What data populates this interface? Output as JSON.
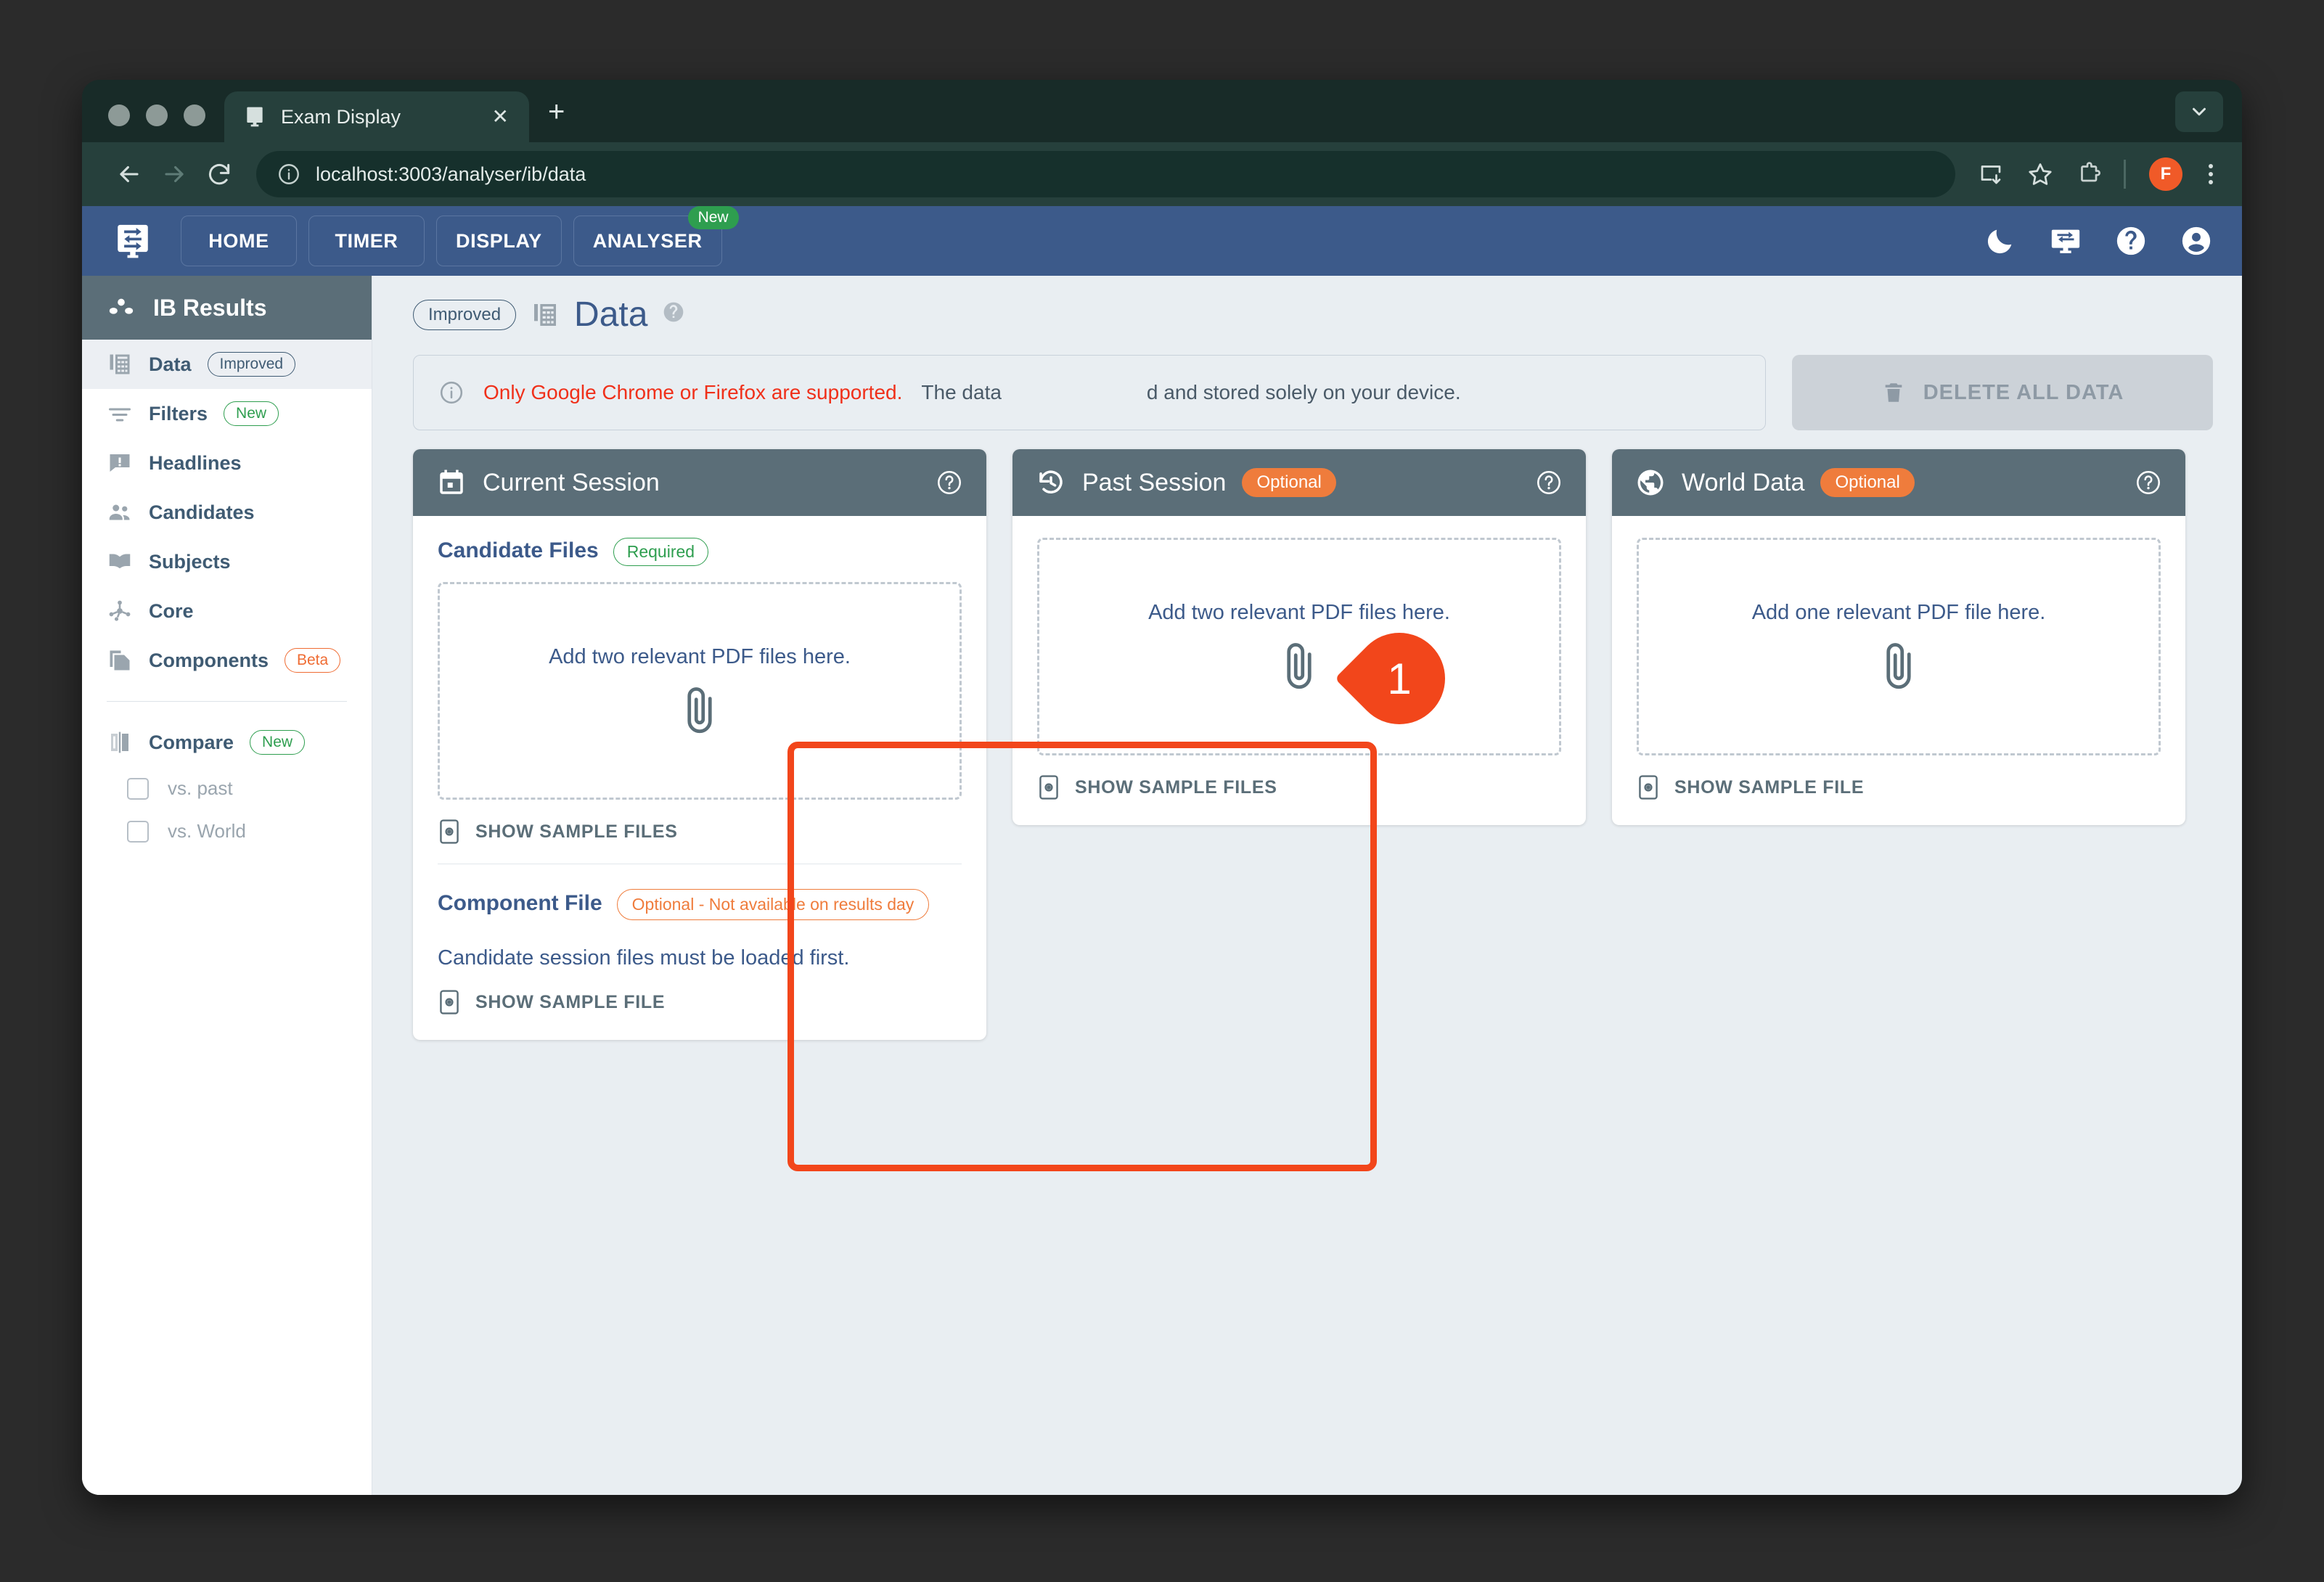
{
  "browser": {
    "tab": {
      "title": "Exam Display",
      "favicon_icon": "exam-display-favicon",
      "close_icon": "close-icon"
    },
    "new_tab_icon": "plus-icon",
    "tab_list_icon": "chevron-down-icon",
    "back_icon": "arrow-left-icon",
    "forward_icon": "arrow-right-icon",
    "reload_icon": "reload-icon",
    "site_info_icon": "info-circle-icon",
    "url": "localhost:3003/analyser/ib/data",
    "install_icon": "install-app-icon",
    "bookmark_icon": "star-icon",
    "extensions_icon": "puzzle-piece-icon",
    "profile_initial": "F",
    "menu_icon": "kebab-menu-icon"
  },
  "app_header": {
    "logo_icon": "exam-display-logo",
    "tabs": [
      {
        "label": "HOME",
        "badge": null
      },
      {
        "label": "TIMER",
        "badge": null
      },
      {
        "label": "DISPLAY",
        "badge": null
      },
      {
        "label": "ANALYSER",
        "badge": "New"
      }
    ],
    "icons": [
      {
        "name": "dark-mode-icon"
      },
      {
        "name": "display-settings-icon"
      },
      {
        "name": "help-icon"
      },
      {
        "name": "account-icon"
      }
    ]
  },
  "sidebar": {
    "title": "IB Results",
    "title_icon": "results-dots-icon",
    "items": [
      {
        "label": "Data",
        "icon": "table-icon",
        "pill": "Improved",
        "pill_type": "improved",
        "active": true
      },
      {
        "label": "Filters",
        "icon": "filter-icon",
        "pill": "New",
        "pill_type": "new",
        "active": false
      },
      {
        "label": "Headlines",
        "icon": "headlines-icon",
        "pill": null,
        "pill_type": null,
        "active": false
      },
      {
        "label": "Candidates",
        "icon": "people-icon",
        "pill": null,
        "pill_type": null,
        "active": false
      },
      {
        "label": "Subjects",
        "icon": "book-icon",
        "pill": null,
        "pill_type": null,
        "active": false
      },
      {
        "label": "Core",
        "icon": "hub-icon",
        "pill": null,
        "pill_type": null,
        "active": false
      },
      {
        "label": "Components",
        "icon": "components-icon",
        "pill": "Beta",
        "pill_type": "beta",
        "active": false
      }
    ],
    "compare": {
      "label": "Compare",
      "icon": "compare-icon",
      "pill": "New",
      "options": [
        {
          "label": "vs. past",
          "checked": false
        },
        {
          "label": "vs. World",
          "checked": false
        }
      ]
    }
  },
  "page": {
    "pill": "Improved",
    "title_icon": "table-icon",
    "title": "Data",
    "help_icon": "help-circle-icon"
  },
  "banner": {
    "icon": "info-circle-icon",
    "warning_text": "Only Google Chrome or Firefox are supported.",
    "rest_text_before": "The data",
    "rest_text_after": "d and stored solely on your device."
  },
  "delete_button": {
    "icon": "trash-icon",
    "label": "DELETE ALL DATA",
    "disabled": true
  },
  "cards": [
    {
      "id": "current-session",
      "icon": "calendar-icon",
      "title": "Current Session",
      "badge": null,
      "help_icon": "help-circle-icon",
      "highlighted": true,
      "fields": [
        {
          "label": "Candidate Files",
          "pill": "Required",
          "pill_type": "required",
          "dropzone_text": "Add two relevant PDF files here.",
          "dropzone_icon": "paperclip-icon",
          "sample_label": "SHOW SAMPLE FILES",
          "sample_icon": "preview-icon"
        },
        {
          "label": "Component File",
          "pill": "Optional - Not available on results day",
          "pill_type": "optional-long",
          "hint": "Candidate session files must be loaded first.",
          "sample_label": "SHOW SAMPLE FILE",
          "sample_icon": "preview-icon"
        }
      ]
    },
    {
      "id": "past-session",
      "icon": "history-icon",
      "title": "Past Session",
      "badge": "Optional",
      "help_icon": "help-circle-icon",
      "highlighted": false,
      "dropzone_text": "Add two relevant PDF files here.",
      "dropzone_icon": "paperclip-icon",
      "sample_label": "SHOW SAMPLE FILES",
      "sample_icon": "preview-icon"
    },
    {
      "id": "world-data",
      "icon": "globe-icon",
      "title": "World Data",
      "badge": "Optional",
      "help_icon": "help-circle-icon",
      "highlighted": false,
      "dropzone_text": "Add one relevant PDF file here.",
      "dropzone_icon": "paperclip-icon",
      "sample_label": "SHOW SAMPLE FILE",
      "sample_icon": "preview-icon"
    }
  ],
  "annotation": {
    "step_number": "1"
  },
  "colors": {
    "brand_blue": "#3c5a8a",
    "card_header": "#5b6e78",
    "accent_orange": "#ef7c3c",
    "highlight_red": "#f2461b",
    "warning_red": "#f0301a",
    "green": "#2e9e4f"
  }
}
